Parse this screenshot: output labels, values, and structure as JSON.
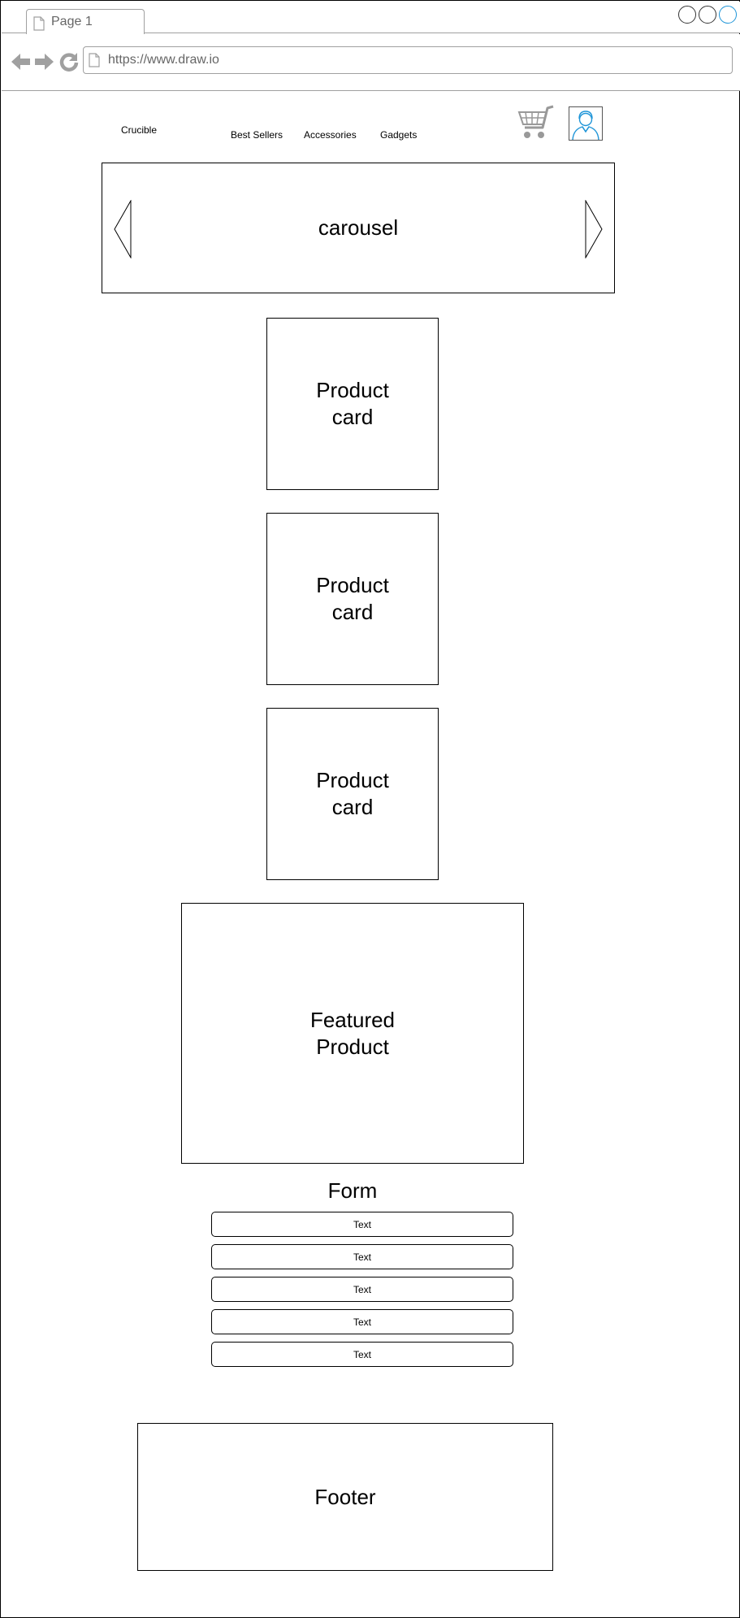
{
  "browser": {
    "tab_title": "Page 1",
    "url": "https://www.draw.io",
    "accent_color": "#1f95d8"
  },
  "header": {
    "brand": "Crucible",
    "nav": [
      "Best Sellers",
      "Accessories",
      "Gadgets"
    ],
    "icons": [
      "cart-icon",
      "user-avatar-icon"
    ]
  },
  "carousel": {
    "label": "carousel",
    "icons": [
      "chevron-left-icon",
      "chevron-right-icon"
    ]
  },
  "product_cards": [
    {
      "label": "Product\ncard"
    },
    {
      "label": "Product\ncard"
    },
    {
      "label": "Product\ncard"
    }
  ],
  "featured": {
    "label": "Featured\nProduct"
  },
  "form": {
    "title": "Form",
    "fields": [
      {
        "value": "Text"
      },
      {
        "value": "Text"
      },
      {
        "value": "Text"
      },
      {
        "value": "Text"
      },
      {
        "value": "Text"
      }
    ]
  },
  "footer": {
    "label": "Footer"
  }
}
